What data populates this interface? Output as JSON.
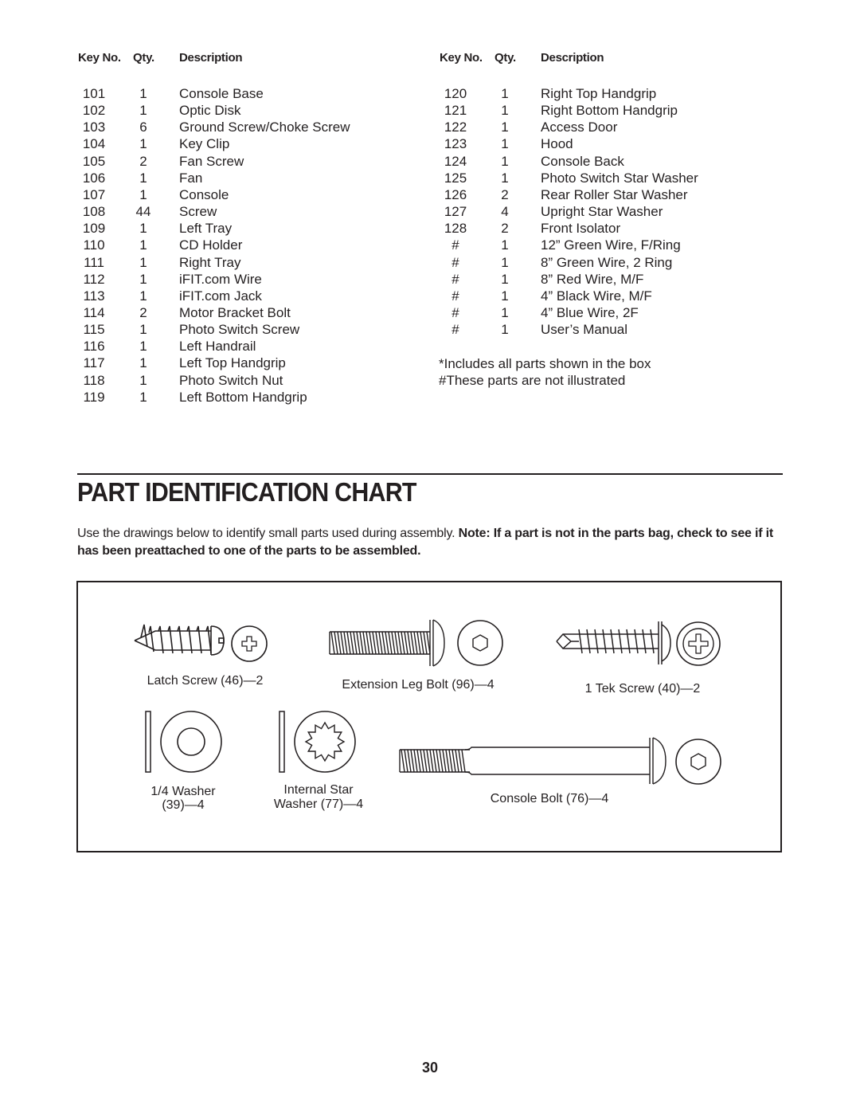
{
  "parts_list": {
    "headers": {
      "key": "Key No.",
      "qty": "Qty.",
      "description": "Description"
    },
    "left_column": [
      {
        "key": "101",
        "qty": "1",
        "description": "Console Base"
      },
      {
        "key": "102",
        "qty": "1",
        "description": "Optic Disk"
      },
      {
        "key": "103",
        "qty": "6",
        "description": "Ground Screw/Choke Screw"
      },
      {
        "key": "104",
        "qty": "1",
        "description": "Key Clip"
      },
      {
        "key": "105",
        "qty": "2",
        "description": "Fan Screw"
      },
      {
        "key": "106",
        "qty": "1",
        "description": "Fan"
      },
      {
        "key": "107",
        "qty": "1",
        "description": "Console"
      },
      {
        "key": "108",
        "qty": "44",
        "description": "Screw"
      },
      {
        "key": "109",
        "qty": "1",
        "description": "Left Tray"
      },
      {
        "key": "110",
        "qty": "1",
        "description": "CD Holder"
      },
      {
        "key": "111",
        "qty": "1",
        "description": "Right Tray"
      },
      {
        "key": "112",
        "qty": "1",
        "description": "iFIT.com Wire"
      },
      {
        "key": "113",
        "qty": "1",
        "description": "iFIT.com Jack"
      },
      {
        "key": "114",
        "qty": "2",
        "description": "Motor Bracket Bolt"
      },
      {
        "key": "115",
        "qty": "1",
        "description": "Photo Switch Screw"
      },
      {
        "key": "116",
        "qty": "1",
        "description": "Left Handrail"
      },
      {
        "key": "117",
        "qty": "1",
        "description": "Left Top Handgrip"
      },
      {
        "key": "118",
        "qty": "1",
        "description": "Photo Switch Nut"
      },
      {
        "key": "119",
        "qty": "1",
        "description": "Left Bottom Handgrip"
      }
    ],
    "right_column": [
      {
        "key": "120",
        "qty": "1",
        "description": "Right Top Handgrip"
      },
      {
        "key": "121",
        "qty": "1",
        "description": "Right Bottom Handgrip"
      },
      {
        "key": "122",
        "qty": "1",
        "description": "Access Door"
      },
      {
        "key": "123",
        "qty": "1",
        "description": "Hood"
      },
      {
        "key": "124",
        "qty": "1",
        "description": "Console Back"
      },
      {
        "key": "125",
        "qty": "1",
        "description": "Photo Switch Star Washer"
      },
      {
        "key": "126",
        "qty": "2",
        "description": "Rear Roller Star Washer"
      },
      {
        "key": "127",
        "qty": "4",
        "description": "Upright Star Washer"
      },
      {
        "key": "128",
        "qty": "2",
        "description": "Front Isolator"
      },
      {
        "key": "#",
        "qty": "1",
        "description": "12” Green Wire, F/Ring"
      },
      {
        "key": "#",
        "qty": "1",
        "description": "8” Green Wire, 2 Ring"
      },
      {
        "key": "#",
        "qty": "1",
        "description": "8” Red Wire, M/F"
      },
      {
        "key": "#",
        "qty": "1",
        "description": "4” Black Wire, M/F"
      },
      {
        "key": "#",
        "qty": "1",
        "description": "4” Blue Wire, 2F"
      },
      {
        "key": "#",
        "qty": "1",
        "description": "User’s Manual"
      }
    ],
    "footnotes": [
      "*Includes all parts shown in the box",
      "#These parts are not illustrated"
    ]
  },
  "section": {
    "title": "PART IDENTIFICATION CHART",
    "intro_plain": "Use the drawings below to identify small parts used during assembly. ",
    "intro_bold": "Note: If a part is not in the parts bag, check to see if it has been preattached to one of the parts to be assembled."
  },
  "chart_parts": {
    "latch_screw": "Latch Screw (46)—2",
    "extension_leg_bolt": "Extension Leg Bolt (96)—4",
    "tek_screw": "1  Tek Screw (40)—2",
    "washer_line1": "1/4  Washer",
    "washer_line2": "(39)—4",
    "star_washer_line1": "Internal Star",
    "star_washer_line2": "Washer (77)—4",
    "console_bolt": "Console Bolt (76)—4"
  },
  "page_number": "30"
}
